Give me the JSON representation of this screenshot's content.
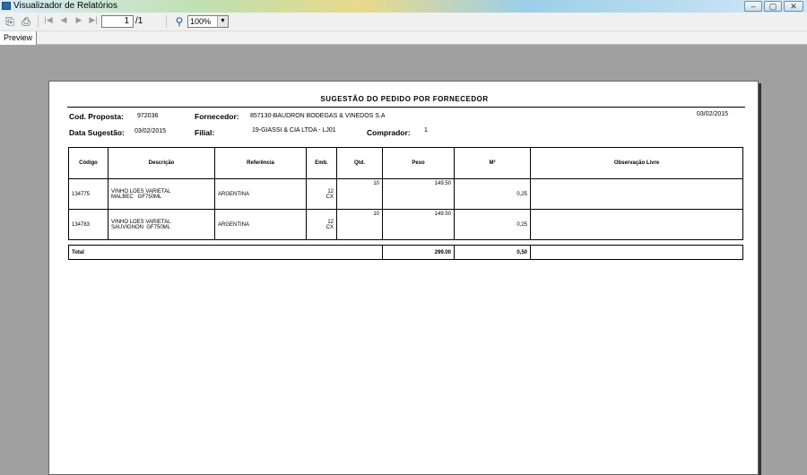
{
  "window": {
    "title": "Visualizador de Relatórios",
    "minimize_icon": "minimize-icon",
    "maximize_icon": "maximize-icon",
    "close_icon": "close-icon"
  },
  "toolbar": {
    "page_current": "1",
    "page_total": "/1",
    "zoom": "100%"
  },
  "tabs": [
    "Preview"
  ],
  "report": {
    "title": "SUGESTÃO DO PEDIDO POR FORNECEDOR",
    "date_top": "03/02/2015",
    "cod_proposta_label": "Cod. Proposta:",
    "cod_proposta": "972036",
    "fornecedor_label": "Fornecedor:",
    "fornecedor": "857130-BAUDRON BODEGAS & VINEDOS S.A",
    "data_sugestao_label": "Data Sugestão:",
    "data_sugestao": "03/02/2015",
    "filial_label": "Filial:",
    "filial": "19-GIASSI & CIA LTDA - LJ01",
    "comprador_label": "Comprador:",
    "comprador": "1",
    "columns": [
      "Código",
      "Descrição",
      "Referência",
      "Emb.",
      "Qtd.",
      "Peso",
      "M³",
      "Observação Livre"
    ],
    "rows": [
      {
        "codigo": "134775",
        "descricao_l1": "VINHO LOES VARIETAL",
        "descricao_l2": "MALBEC   GF750ML",
        "referencia": "ARGENTINA",
        "emb_qty": "12",
        "emb_unit": "CX",
        "qtd": "10",
        "peso": "149.50",
        "m3": "0,25",
        "obs": ""
      },
      {
        "codigo": "134783",
        "descricao_l1": "VINHO LOES VARIETAL",
        "descricao_l2": "SAUVIGNON  GF750ML",
        "referencia": "ARGENTINA",
        "emb_qty": "12",
        "emb_unit": "CX",
        "qtd": "10",
        "peso": "149.50",
        "m3": "0,25",
        "obs": ""
      }
    ],
    "total_label": "Total",
    "total_peso": "299.00",
    "total_m3": "0,50"
  }
}
